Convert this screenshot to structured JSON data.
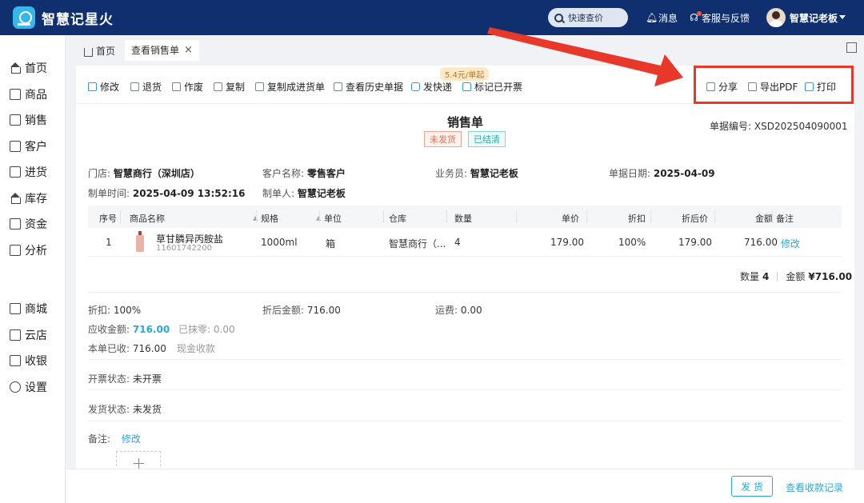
{
  "app": {
    "title": "智慧记星火"
  },
  "header": {
    "quick_search": "快速查价",
    "messages": "消息",
    "support": "客服与反馈",
    "user_name": "智慧记老板"
  },
  "sidebar": {
    "items": [
      {
        "label": "首页",
        "icon": "home-icon"
      },
      {
        "label": "商品",
        "icon": "goods-icon"
      },
      {
        "label": "销售",
        "icon": "sales-icon"
      },
      {
        "label": "客户",
        "icon": "customer-icon"
      },
      {
        "label": "进货",
        "icon": "purchase-icon"
      },
      {
        "label": "库存",
        "icon": "stock-icon"
      },
      {
        "label": "资金",
        "icon": "fund-icon"
      },
      {
        "label": "分析",
        "icon": "chart-icon"
      },
      {
        "label": "商城",
        "icon": "mall-icon"
      },
      {
        "label": "云店",
        "icon": "cloud-store-icon"
      },
      {
        "label": "收银",
        "icon": "cashier-icon"
      },
      {
        "label": "设置",
        "icon": "gear-icon"
      }
    ]
  },
  "tabs": {
    "home": "首页",
    "active": "查看销售单",
    "close": "×"
  },
  "toolbar": {
    "edit": "修改",
    "return": "退货",
    "void": "作废",
    "copy": "复制",
    "copy_purchase": "复制成进货单",
    "history": "查看历史单据",
    "express": "发快递",
    "express_promo": "5.4元/单起",
    "mark_invoiced": "标记已开票",
    "share": "分享",
    "export_pdf": "导出PDF",
    "print": "打印"
  },
  "doc": {
    "title": "销售单",
    "status_shipping": "未发货",
    "status_settlement": "已结清",
    "number_label": "单据编号:",
    "number": "XSD202504090001",
    "store_label": "门店:",
    "store": "智慧商行（深圳店）",
    "customer_label": "客户名称:",
    "customer": "零售客户",
    "salesperson_label": "业务员:",
    "salesperson": "智慧记老板",
    "date_label": "单据日期:",
    "date": "2025-04-09",
    "created_label": "制单时间:",
    "created": "2025-04-09 13:52:16",
    "maker_label": "制单人:",
    "maker": "智慧记老板"
  },
  "table": {
    "headers": {
      "seq": "序号",
      "name": "商品名称",
      "spec": "规格",
      "unit": "单位",
      "warehouse": "仓库",
      "qty": "数量",
      "price": "单价",
      "discount": "折扣",
      "disc_price": "折后价",
      "amount": "金额",
      "remark": "备注"
    },
    "rows": [
      {
        "seq": "1",
        "name": "草甘膦异丙胺盐",
        "code": "11601742200",
        "spec": "1000ml",
        "unit": "箱",
        "warehouse": "智慧商行（...",
        "qty": "4",
        "price": "179.00",
        "discount": "100%",
        "disc_price": "179.00",
        "amount": "716.00",
        "remark": "修改"
      }
    ],
    "summary": {
      "qty_label": "数量",
      "qty": "4",
      "amount_label": "金额",
      "amount": "¥716.00"
    }
  },
  "totals": {
    "discount_label": "折扣:",
    "discount": "100%",
    "after_disc_label": "折后金额:",
    "after_disc": "716.00",
    "freight_label": "运费:",
    "freight": "0.00",
    "receivable_label": "应收金额:",
    "receivable": "716.00",
    "erased_label": "已抹零:",
    "erased": "0.00",
    "received_label": "本单已收:",
    "received": "716.00",
    "pay_method": "现金收款",
    "invoice_label": "开票状态:",
    "invoice": "未开票",
    "ship_label": "发货状态:",
    "ship": "未发货",
    "remark_label": "备注:",
    "remark_edit": "修改"
  },
  "footer": {
    "ship_button": "发 货",
    "records_link": "查看收款记录"
  },
  "colors": {
    "header_bg": "#0f2f6e",
    "accent": "#2aa7d9",
    "highlight": "#e8382a"
  }
}
